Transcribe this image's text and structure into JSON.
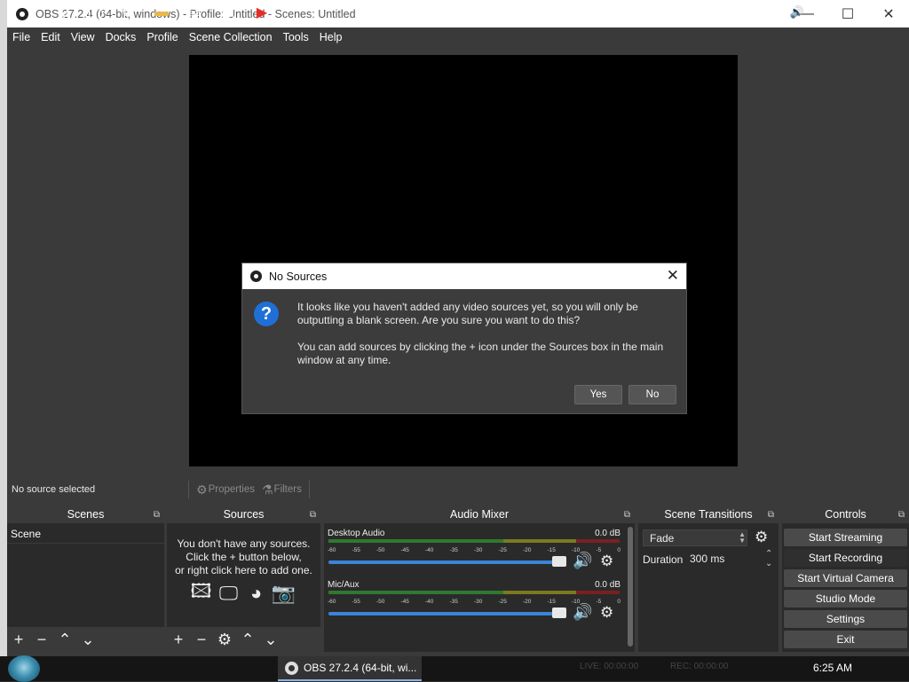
{
  "window": {
    "title": "OBS 27.2.4 (64-bit, windows) - Profile: Untitled - Scenes: Untitled",
    "minimize_icon": "—",
    "maximize_icon": "☐",
    "close_icon": "✕"
  },
  "menu": [
    "File",
    "Edit",
    "View",
    "Docks",
    "Profile",
    "Scene Collection",
    "Tools",
    "Help"
  ],
  "dialog": {
    "title": "No Sources",
    "line1": "It looks like you haven't added any video sources yet, so you will only be outputting a blank screen. Are you sure you want to do this?",
    "line2": "You can add sources by clicking the + icon under the Sources box in the main window at any time.",
    "yes": "Yes",
    "no": "No",
    "close": "✕"
  },
  "source_bar": {
    "status": "No source selected",
    "properties": "Properties",
    "filters": "Filters"
  },
  "scenes": {
    "title": "Scenes",
    "items": [
      "Scene"
    ]
  },
  "sources": {
    "title": "Sources",
    "empty_line1": "You don't have any sources.",
    "empty_line2": "Click the + button below,",
    "empty_line3": "or right click here to add one."
  },
  "mixer": {
    "title": "Audio Mixer",
    "tracks": [
      {
        "name": "Desktop Audio",
        "db": "0.0 dB"
      },
      {
        "name": "Mic/Aux",
        "db": "0.0 dB"
      }
    ],
    "ticks": [
      "-60",
      "-55",
      "-50",
      "-45",
      "-40",
      "-35",
      "-30",
      "-25",
      "-20",
      "-15",
      "-10",
      "-5",
      "0"
    ]
  },
  "transitions": {
    "title": "Scene Transitions",
    "selected": "Fade",
    "duration_label": "Duration",
    "duration_value": "300 ms"
  },
  "controls": {
    "title": "Controls",
    "buttons": [
      "Start Streaming",
      "Start Recording",
      "Start Virtual Camera",
      "Studio Mode",
      "Settings",
      "Exit"
    ]
  },
  "taskbar": {
    "obs_task": "OBS 27.2.4 (64-bit, wi...",
    "live": "LIVE: 00:00:00",
    "rec": "REC: 00:00:00",
    "clock": "6:25 AM"
  },
  "colors": {
    "accent": "#3b84d6",
    "question_icon": "#1f6fd6",
    "dock_bg": "#2a2a2a",
    "panel_bg": "#3a3a3a"
  }
}
